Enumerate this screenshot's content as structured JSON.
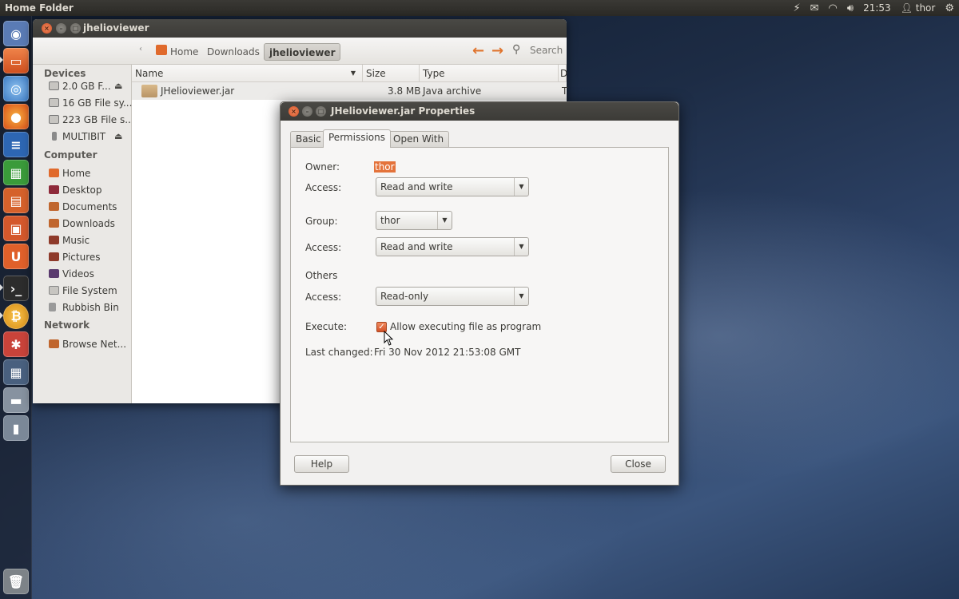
{
  "top_panel": {
    "app_title": "Home Folder",
    "time": "21:53",
    "user": "thor",
    "icons": [
      "bolt-icon",
      "mail-icon",
      "wifi-icon",
      "volume-icon",
      "user-icon",
      "gear-icon"
    ]
  },
  "launcher": {
    "items": [
      {
        "name": "dash-home",
        "color": "#5a7bb5"
      },
      {
        "name": "files",
        "color": "#e06a2c"
      },
      {
        "name": "chromium",
        "color": "#4a8ad0"
      },
      {
        "name": "firefox",
        "color": "#e45d1e"
      },
      {
        "name": "writer",
        "color": "#2d66b3"
      },
      {
        "name": "calc",
        "color": "#3a9b3a"
      },
      {
        "name": "impress",
        "color": "#d5612b"
      },
      {
        "name": "software-center",
        "color": "#d4582c"
      },
      {
        "name": "ubuntu-one",
        "color": "#e0602a"
      },
      {
        "name": "terminal",
        "color": "#2c2c2c"
      },
      {
        "name": "multibit",
        "color": "#e8a220"
      },
      {
        "name": "system-settings",
        "color": "#c9433a"
      },
      {
        "name": "workspace-switcher",
        "color": "#49607f"
      },
      {
        "name": "drive",
        "color": "#8792a0"
      },
      {
        "name": "usb-drive",
        "color": "#7b8898"
      },
      {
        "name": "trash",
        "color": "#7d8388"
      }
    ]
  },
  "file_manager": {
    "title": "jhelioviewer",
    "breadcrumbs": [
      "Home",
      "Downloads",
      "jhelioviewer"
    ],
    "search_label": "Search",
    "sidebar": {
      "devices_header": "Devices",
      "devices": [
        "2.0 GB F...",
        "16 GB File sy...",
        "223 GB File s...",
        "MULTIBIT"
      ],
      "computer_header": "Computer",
      "computer": [
        "Home",
        "Desktop",
        "Documents",
        "Downloads",
        "Music",
        "Pictures",
        "Videos",
        "File System",
        "Rubbish Bin"
      ],
      "network_header": "Network",
      "network": [
        "Browse Net..."
      ]
    },
    "columns": {
      "name": "Name",
      "size": "Size",
      "type": "Type",
      "date": "D"
    },
    "files": [
      {
        "name": "JHelioviewer.jar",
        "size": "3.8 MB",
        "type": "Java archive",
        "date": "T"
      }
    ]
  },
  "properties": {
    "title": "JHelioviewer.jar Properties",
    "tabs": [
      "Basic",
      "Permissions",
      "Open With"
    ],
    "active_tab": "Permissions",
    "owner_label": "Owner:",
    "owner_value": "thor",
    "owner_access_label": "Access:",
    "owner_access": "Read and write",
    "group_label": "Group:",
    "group_value": "thor",
    "group_access_label": "Access:",
    "group_access": "Read and write",
    "others_label": "Others",
    "others_access_label": "Access:",
    "others_access": "Read-only",
    "execute_label": "Execute:",
    "execute_checkbox_label": "Allow executing file as program",
    "execute_checked": true,
    "last_changed_label": "Last changed:",
    "last_changed_value": "Fri 30 Nov 2012 21:53:08 GMT",
    "help_button": "Help",
    "close_button": "Close"
  },
  "colors": {
    "accent": "#e4733b",
    "panel": "#3c3b37",
    "window_bg": "#f2f1f0"
  }
}
